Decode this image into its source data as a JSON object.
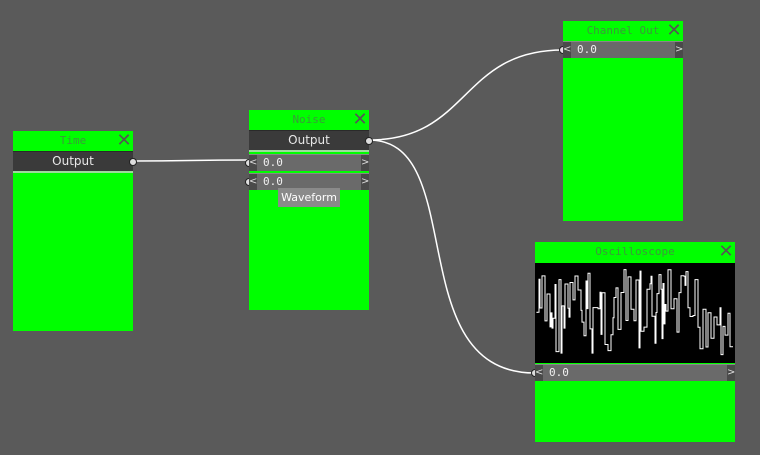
{
  "nodes": {
    "time": {
      "title": "Time",
      "output_label": "Output"
    },
    "noise": {
      "title": "Noise",
      "output_label": "Output",
      "field1_value": "0.0",
      "field2_value": "0.0",
      "waveform_label": "Waveform"
    },
    "channel_out": {
      "title": "Channel Out",
      "field_value": "0.0"
    },
    "oscilloscope": {
      "title": "Oscilloscope",
      "field_value": "0.0"
    }
  },
  "icons": {
    "close": "close-x-icon",
    "left_arrow": "chevron-left-icon",
    "right_arrow": "chevron-right-icon"
  },
  "colors": {
    "node_bg": "#00ff00",
    "canvas_bg": "#5a5a5a",
    "wire": "#ffffff",
    "scope_bg": "#000000"
  }
}
